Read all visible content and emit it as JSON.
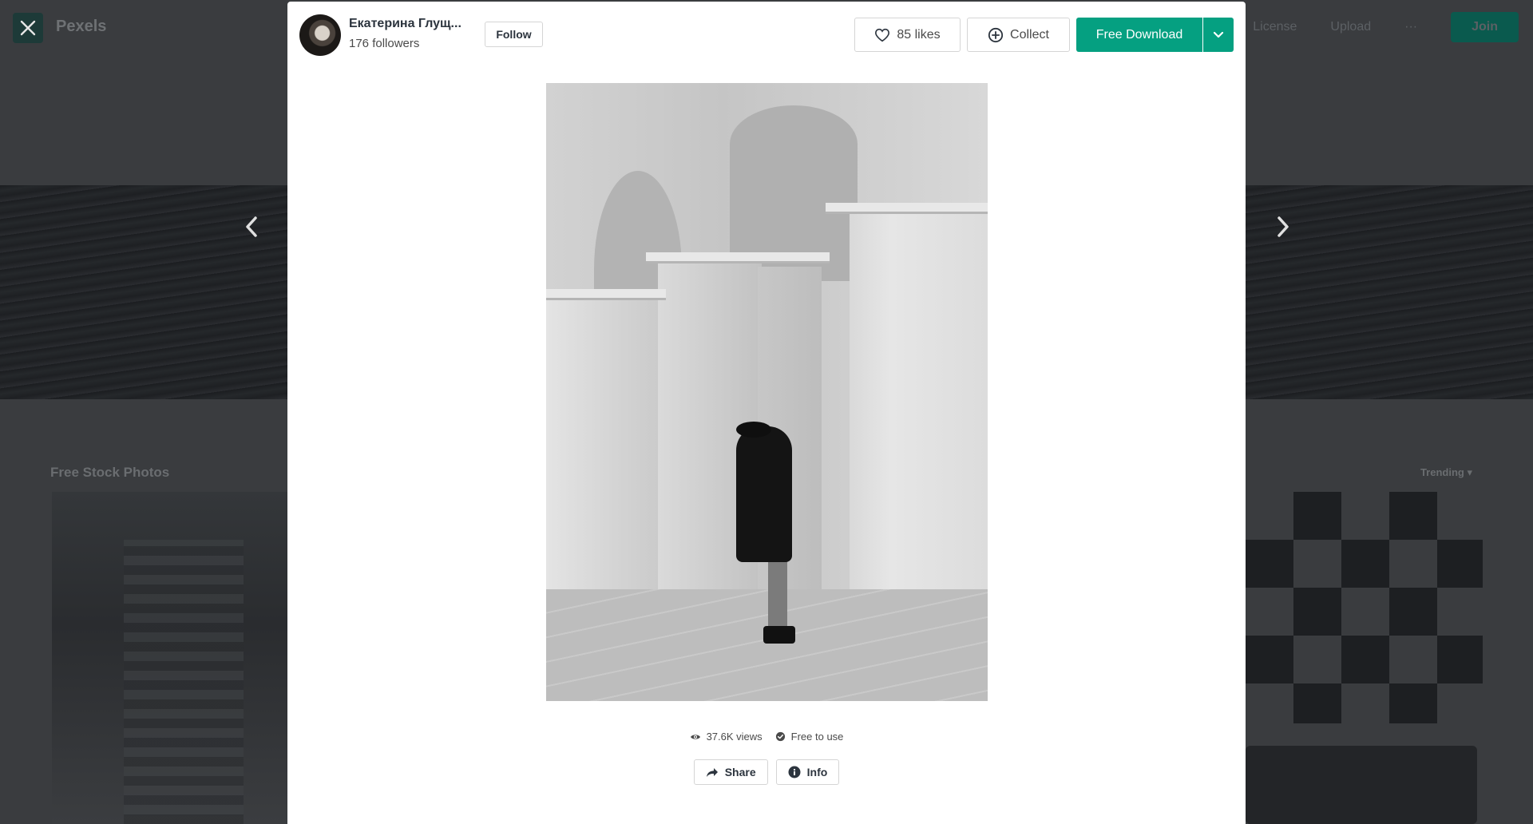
{
  "background": {
    "logo_text": "Pexels",
    "nav_items": [
      "License",
      "Upload",
      "···"
    ],
    "join_label": "Join",
    "section_title": "Free Stock Photos",
    "sort_label": "Trending"
  },
  "author": {
    "name": "Екатерина Глущ...",
    "followers": "176 followers",
    "follow_label": "Follow"
  },
  "toolbar": {
    "likes_label": "85 likes",
    "collect_label": "Collect",
    "download_label": "Free Download"
  },
  "meta": {
    "views": "37.6K views",
    "license": "Free to use"
  },
  "actions": {
    "share_label": "Share",
    "info_label": "Info"
  },
  "icons": {
    "close": "close-icon",
    "prev": "chevron-left-icon",
    "next": "chevron-right-icon",
    "heart": "heart-icon",
    "plus": "plus-circle-icon",
    "dropdown": "chevron-down-icon",
    "eye": "eye-icon",
    "check": "check-circle-icon",
    "share": "share-arrow-icon",
    "info": "info-icon"
  },
  "colors": {
    "accent": "#05a081",
    "backdrop": "#2c2f33",
    "modal_bg": "#ffffff",
    "text_dark": "#2c343e"
  }
}
